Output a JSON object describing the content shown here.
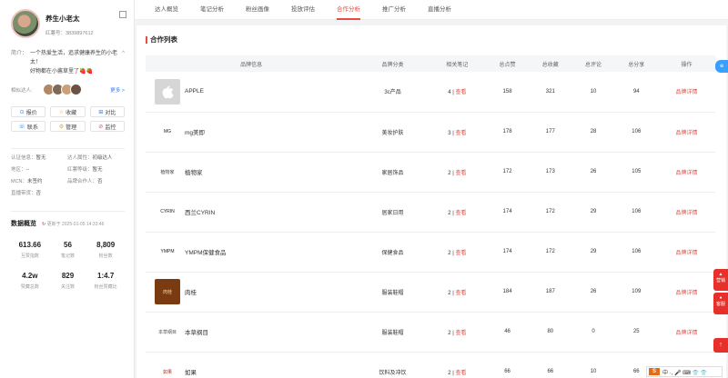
{
  "profile": {
    "name": "养生小老太",
    "id": "红薯号：3839897612",
    "intro_label": "简介：",
    "intro_line1": "一个热爱生活，追求健康养生的小老太！",
    "intro_line2": "好物都在小酱草里了🍓🍓",
    "collapse": "^",
    "similar_label": "相似达人:",
    "more": "更多 >"
  },
  "actions": [
    {
      "icon": "⊙",
      "label": "报价",
      "color": "#2d7ff9"
    },
    {
      "icon": "☆",
      "label": "收藏",
      "color": "#e6a23c"
    },
    {
      "icon": "⊞",
      "label": "对比",
      "color": "#2d7ff9"
    },
    {
      "icon": "☏",
      "label": "联系",
      "color": "#2d7ff9"
    },
    {
      "icon": "⚙",
      "label": "管理",
      "color": "#e6a23c"
    },
    {
      "icon": "⊘",
      "label": "监控",
      "color": "#e54d42"
    }
  ],
  "attrs": [
    {
      "k": "认证信息：",
      "v": "暂无"
    },
    {
      "k": "达人属性：",
      "v": "初级达人"
    },
    {
      "k": "地区：",
      "v": "--"
    },
    {
      "k": "红薯等级：",
      "v": "暂无"
    },
    {
      "k": "MCN：",
      "v": "未签约"
    },
    {
      "k": "品牌合作人：",
      "v": "否"
    },
    {
      "k": "直播带货：",
      "v": "否"
    }
  ],
  "overview": {
    "title": "数据概览",
    "updated_prefix": "更新于",
    "updated": "2025-01-05 14:33:46"
  },
  "stats": [
    {
      "v": "613.66",
      "l": "互赞指数"
    },
    {
      "v": "56",
      "l": "笔记数"
    },
    {
      "v": "8,809",
      "l": "粉丝数"
    },
    {
      "v": "4.2w",
      "l": "赞藏总数"
    },
    {
      "v": "829",
      "l": "关注数"
    },
    {
      "v": "1:4.7",
      "l": "粉丝赞藏比"
    }
  ],
  "tabs": [
    "达人概览",
    "笔记分析",
    "粉丝画像",
    "投放评估",
    "合作分析",
    "推广分析",
    "直播分析"
  ],
  "active_tab": 4,
  "list_title": "合作列表",
  "columns": [
    "品牌信息",
    "品牌分类",
    "相关笔记",
    "总点赞",
    "总收藏",
    "总评论",
    "总分享",
    "操作"
  ],
  "rows": [
    {
      "name": "APPLE",
      "logo": "",
      "logo_bg": "#d6d6d6",
      "logo_fg": "#fff",
      "cat": "3c产品",
      "notes": "4",
      "likes": "158",
      "favs": "321",
      "cmts": "10",
      "shares": "94"
    },
    {
      "name": "mg美即",
      "logo": "MG",
      "logo_bg": "#fff",
      "logo_fg": "#222",
      "cat": "美妆护肤",
      "notes": "3",
      "likes": "178",
      "favs": "177",
      "cmts": "28",
      "shares": "106"
    },
    {
      "name": "植物家",
      "logo": "植物家",
      "logo_bg": "#fff",
      "logo_fg": "#444",
      "cat": "家居饰品",
      "notes": "2",
      "likes": "172",
      "favs": "173",
      "cmts": "26",
      "shares": "105"
    },
    {
      "name": "西兰CYRIN",
      "logo": "CYRIN",
      "logo_bg": "#fff",
      "logo_fg": "#222",
      "cat": "居家日用",
      "notes": "2",
      "likes": "174",
      "favs": "172",
      "cmts": "29",
      "shares": "106"
    },
    {
      "name": "YMPM保健食品",
      "logo": "YMPM",
      "logo_bg": "#fff",
      "logo_fg": "#222",
      "cat": "保健食品",
      "notes": "2",
      "likes": "174",
      "favs": "172",
      "cmts": "29",
      "shares": "106"
    },
    {
      "name": "肉桂",
      "logo": "肉桂",
      "logo_bg": "#7a3b12",
      "logo_fg": "#f3d9b0",
      "cat": "服装鞋帽",
      "notes": "2",
      "likes": "184",
      "favs": "187",
      "cmts": "26",
      "shares": "109"
    },
    {
      "name": "本草纲目",
      "logo": "本草纲目",
      "logo_bg": "#fff",
      "logo_fg": "#555",
      "cat": "服装鞋帽",
      "notes": "2",
      "likes": "46",
      "favs": "80",
      "cmts": "0",
      "shares": "25"
    },
    {
      "name": "如果",
      "logo": "如果",
      "logo_bg": "#fff",
      "logo_fg": "#c0281e",
      "cat": "饮料及冲饮",
      "notes": "2",
      "likes": "66",
      "favs": "66",
      "cmts": "10",
      "shares": "66"
    }
  ],
  "view_label": "查看",
  "detail_label": "品牌详情",
  "float": {
    "blue": "⊕",
    "red1": "营销",
    "red2": "客服"
  },
  "tray": "中 ·, 🎤 ⌨ 👕 👕"
}
